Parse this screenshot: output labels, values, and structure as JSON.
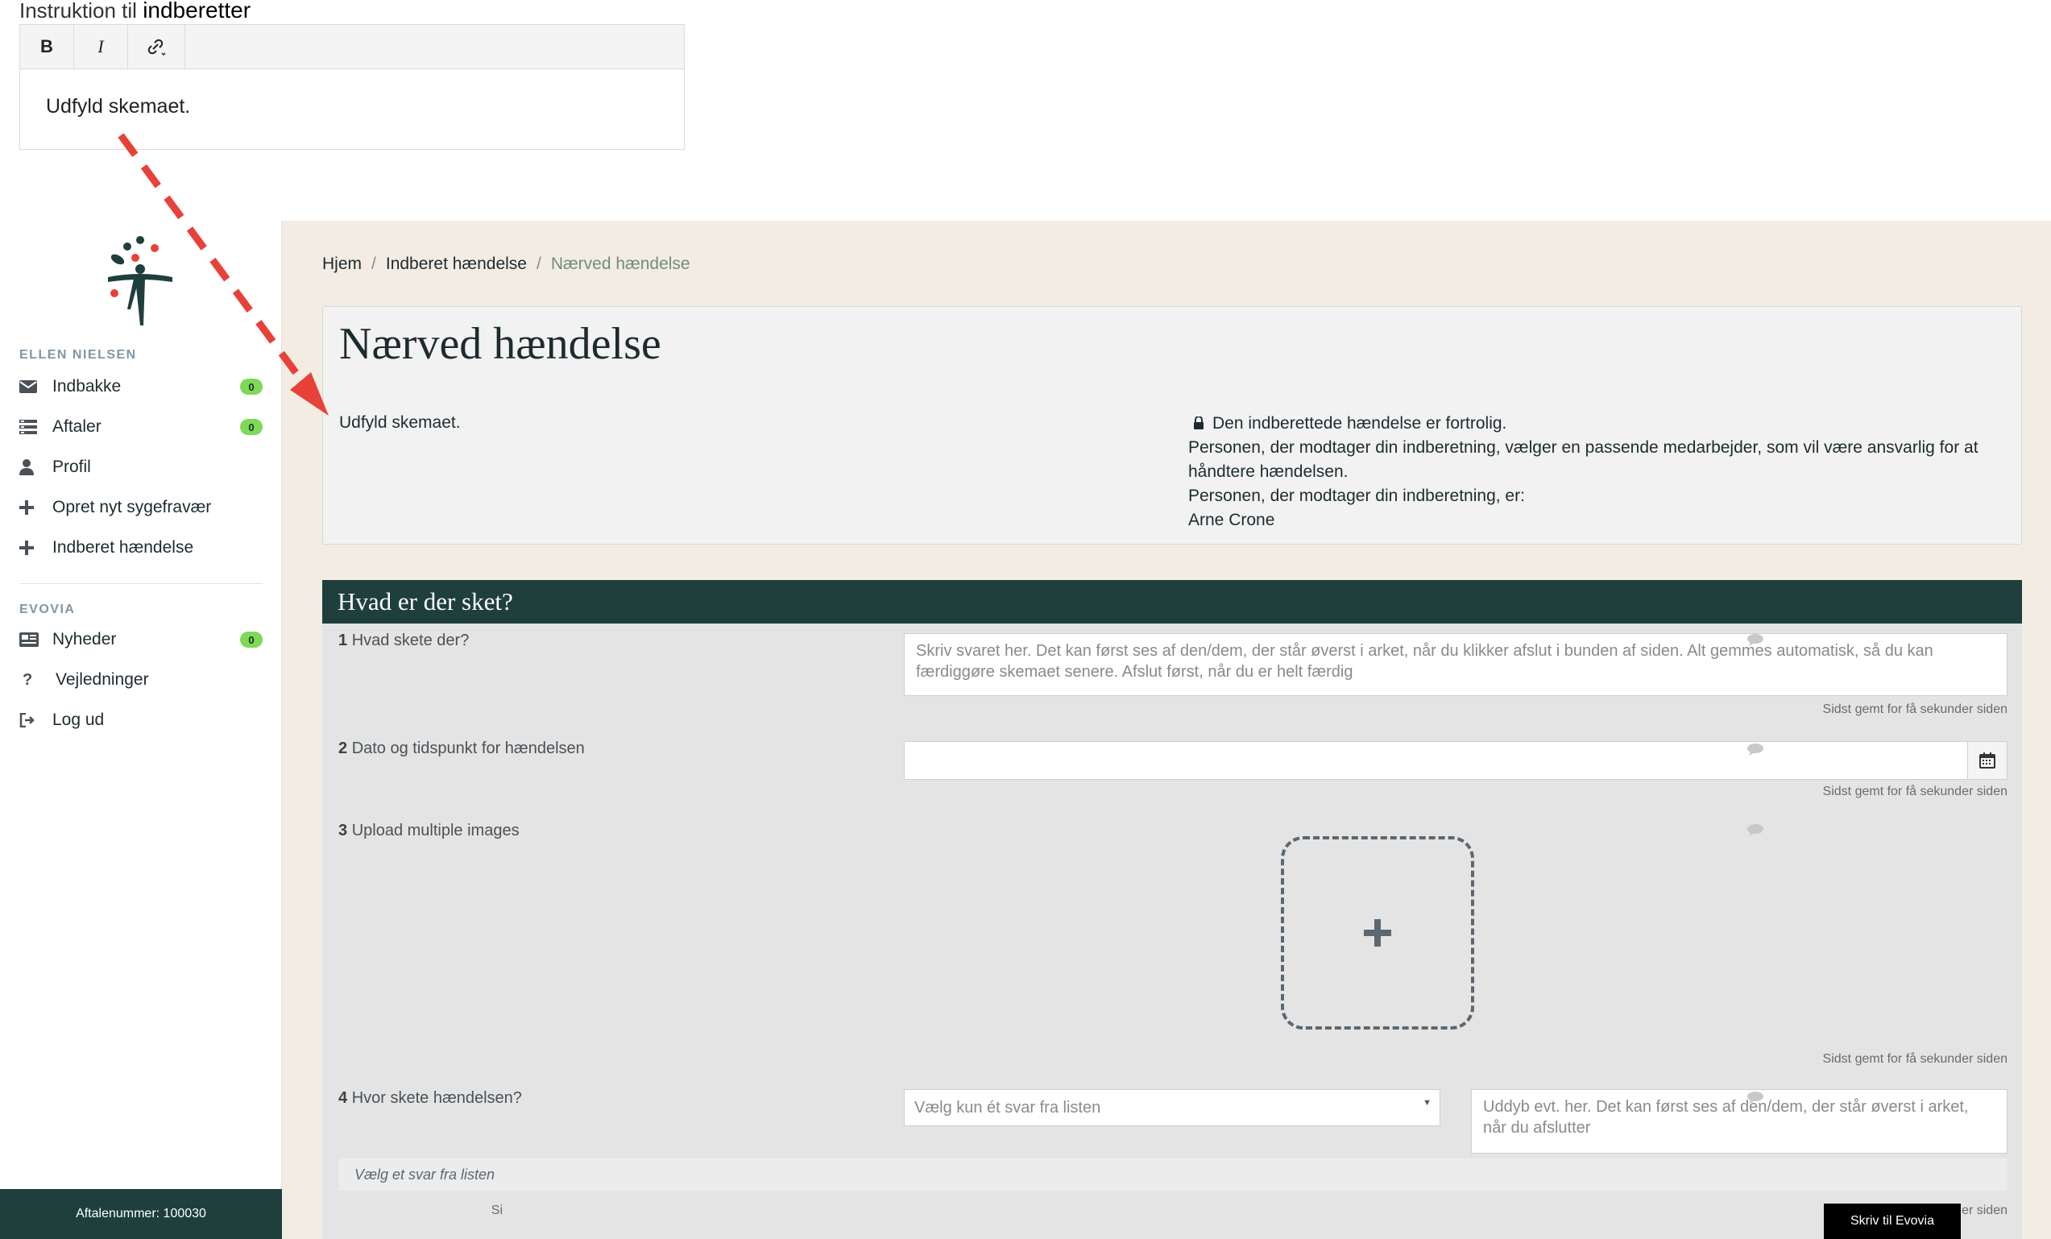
{
  "instruction_editor": {
    "title_prefix": "Instruktion til",
    "title_word": "indberetter",
    "toolbar": {
      "bold": "B",
      "italic": "I"
    },
    "body_text": "Udfyld skemaet."
  },
  "sidebar": {
    "user_section": "ELLEN NIELSEN",
    "user_items": [
      {
        "label": "Indbakke",
        "icon": "envelope-icon",
        "badge": "0"
      },
      {
        "label": "Aftaler",
        "icon": "list-icon",
        "badge": "0"
      },
      {
        "label": "Profil",
        "icon": "user-icon"
      },
      {
        "label": "Opret nyt sygefravær",
        "icon": "plus-icon"
      },
      {
        "label": "Indberet hændelse",
        "icon": "plus-icon"
      }
    ],
    "org_section": "EVOVIA",
    "org_items": [
      {
        "label": "Nyheder",
        "icon": "newspaper-icon",
        "badge": "0"
      },
      {
        "label": "Vejledninger",
        "icon": "question-icon"
      },
      {
        "label": "Log ud",
        "icon": "logout-icon"
      }
    ],
    "footer": "Aftalenummer: 100030"
  },
  "breadcrumb": {
    "home": "Hjem",
    "parent": "Indberet hændelse",
    "current": "Nærved hændelse",
    "separator": "/"
  },
  "intro": {
    "title": "Nærved hændelse",
    "instruction": "Udfyld skemaet.",
    "confidential": "Den indberettede hændelse er fortrolig.",
    "receiver_note": "Personen, der modtager din indberetning, vælger en passende medarbejder, som vil være ansvarlig for at håndtere hændelsen.",
    "receiver_label": "Personen, der modtager din indberetning, er:",
    "receiver_name": "Arne Crone"
  },
  "section": {
    "title": "Hvad er der sket?",
    "questions": [
      {
        "num": "1",
        "label": "Hvad skete der?",
        "placeholder": "Skriv svaret her. Det kan først ses af den/dem, der står øverst i arket, når du klikker afslut i bunden af siden. Alt gemmes automatisk, så du kan færdiggøre skemaet senere. Afslut først, når du er helt færdig",
        "saved": "Sidst gemt for få sekunder siden"
      },
      {
        "num": "2",
        "label": "Dato og tidspunkt for hændelsen",
        "value": "",
        "saved": "Sidst gemt for få sekunder siden"
      },
      {
        "num": "3",
        "label": "Upload multiple images",
        "saved": "Sidst gemt for få sekunder siden"
      },
      {
        "num": "4",
        "label": "Hvor skete hændelsen?",
        "select_placeholder": "Vælg kun ét svar fra listen",
        "details_placeholder": "Uddyb evt. her. Det kan først ses af den/dem, der står øverst i arket, når du afslutter",
        "hint": "Vælg et svar fra listen",
        "saved_visible_start": "Si",
        "saved_visible_end": "er siden"
      }
    ]
  },
  "chat_button": "Skriv til Evovia",
  "colors": {
    "dark_green": "#1f3f3d",
    "beige_bg": "#f3ece2",
    "badge_green": "#7ed957",
    "arrow_red": "#e8413a"
  }
}
